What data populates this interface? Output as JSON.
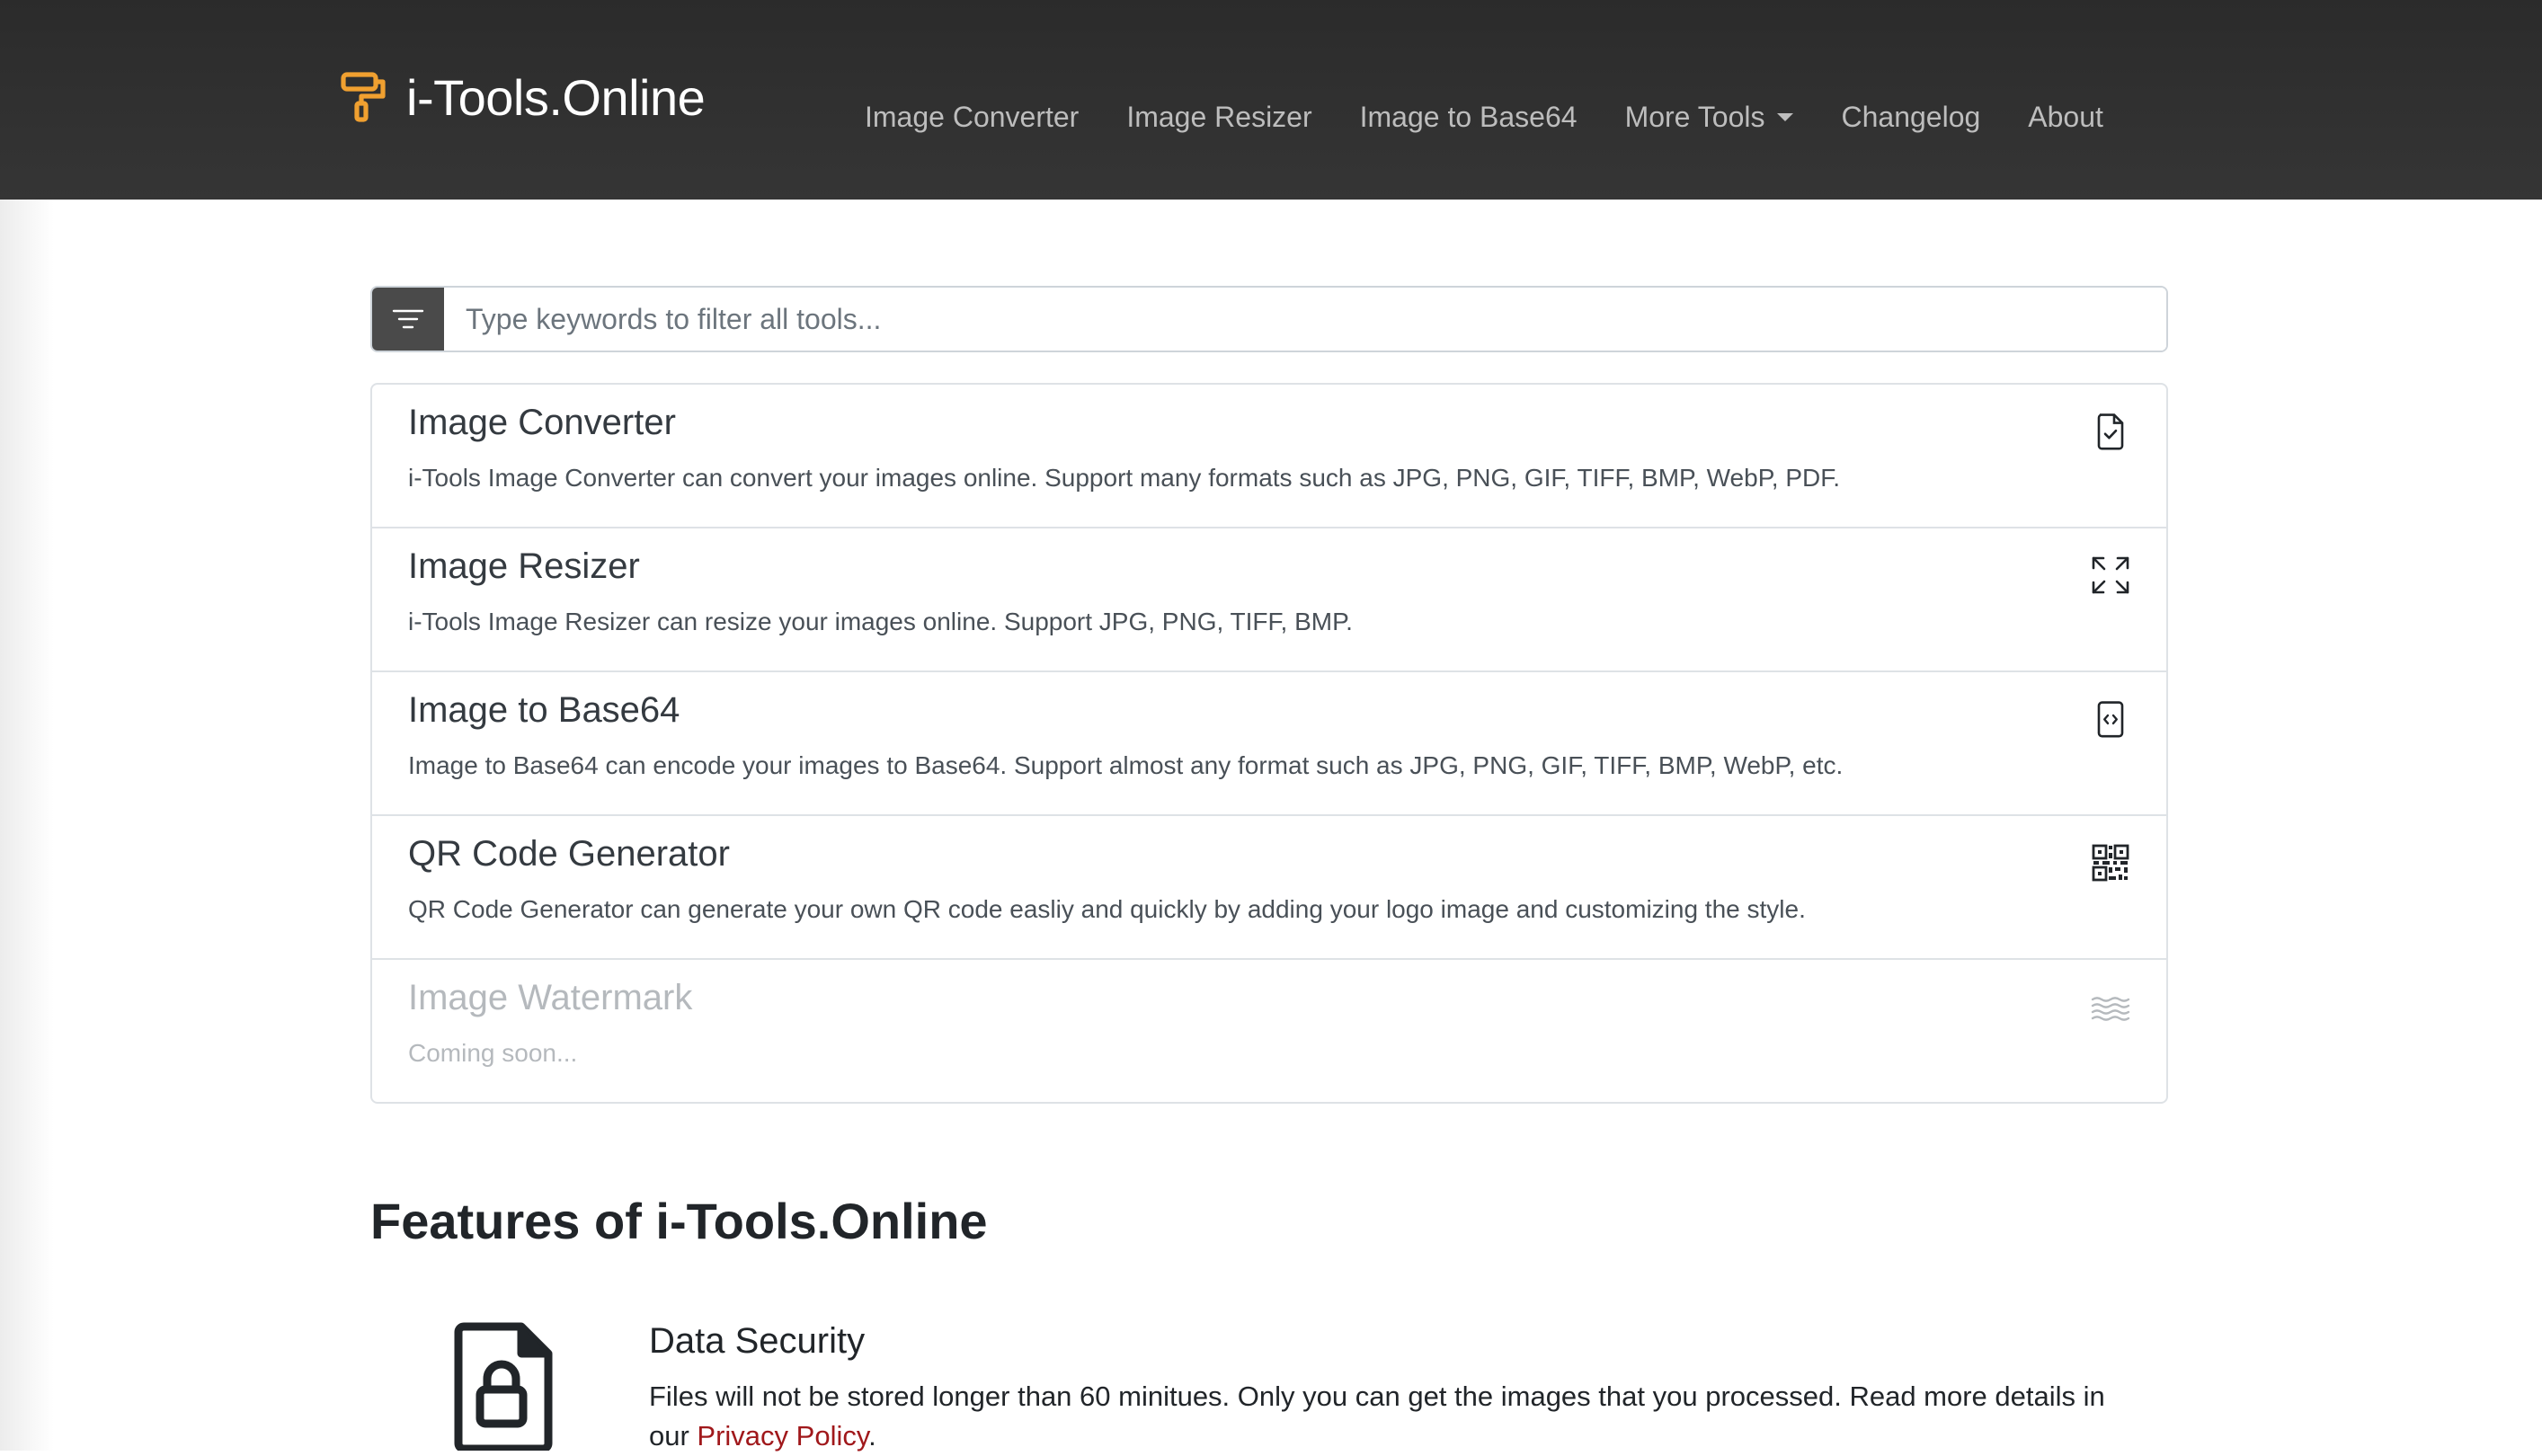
{
  "header": {
    "brand": "i-Tools.Online",
    "brand_color": "#f0a030",
    "nav": [
      {
        "label": "Image Converter"
      },
      {
        "label": "Image Resizer"
      },
      {
        "label": "Image to Base64"
      },
      {
        "label": "More Tools",
        "dropdown": true
      },
      {
        "label": "Changelog"
      },
      {
        "label": "About"
      }
    ]
  },
  "filter": {
    "placeholder": "Type keywords to filter all tools...",
    "value": "",
    "icon": "filter-lines-icon"
  },
  "tools": [
    {
      "title": "Image Converter",
      "description": "i-Tools Image Converter can convert your images online. Support many formats such as JPG, PNG, GIF, TIFF, BMP, WebP, PDF.",
      "icon": "file-check-icon",
      "enabled": true
    },
    {
      "title": "Image Resizer",
      "description": "i-Tools Image Resizer can resize your images online. Support JPG, PNG, TIFF, BMP.",
      "icon": "arrows-expand-icon",
      "enabled": true
    },
    {
      "title": "Image to Base64",
      "description": "Image to Base64 can encode your images to Base64. Support almost any format such as JPG, PNG, GIF, TIFF, BMP, WebP, etc.",
      "icon": "file-code-icon",
      "enabled": true
    },
    {
      "title": "QR Code Generator",
      "description": "QR Code Generator can generate your own QR code easliy and quickly by adding your logo image and customizing the style.",
      "icon": "qr-code-icon",
      "enabled": true
    },
    {
      "title": "Image Watermark",
      "description": "Coming soon...",
      "icon": "water-waves-icon",
      "enabled": false
    }
  ],
  "features": {
    "title": "Features of i-Tools.Online",
    "items": [
      {
        "title": "Data Security",
        "description_before": "Files will not be stored longer than 60 minitues. Only you can get the images that you processed. Read more details in our ",
        "link": "Privacy Policy",
        "description_after": ".",
        "icon": "file-lock-icon"
      }
    ]
  },
  "colors": {
    "navbar": "#2f2f2f",
    "nav_text": "#bdbdbd",
    "link": "#a0181b",
    "border": "#dee2e6",
    "filter_button": "#4a4a4a"
  }
}
